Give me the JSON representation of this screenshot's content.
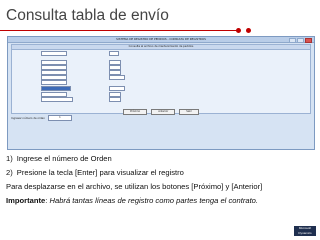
{
  "slide": {
    "title": "Consulta tabla de envío",
    "accent_color": "#c00000"
  },
  "window": {
    "title": "SISTEMA DE REGISTRO DE PEDIDOS - CONSULTA DE REGISTROS",
    "inner_title": "Consulta al archivo de mantenimiento de pedidos",
    "buttons": [
      "Próximo",
      "Anterior",
      "Salir"
    ],
    "orden_label": "Ingresar número de orden",
    "orden_value": "1"
  },
  "instructions": {
    "items": [
      {
        "num": "1)",
        "text": "Ingrese el número de Orden"
      },
      {
        "num": "2)",
        "text": "Presione la tecla [Enter] para visualizar el registro"
      }
    ],
    "note": "Para desplazarse en el archivo, se utilizan los botones [Próximo] y [Anterior]",
    "important_label": "Importante",
    "important_text": "Habrá tantas líneas de registro como partes tenga el contrato."
  },
  "logo": {
    "text": "Microsoft Dynamics"
  }
}
